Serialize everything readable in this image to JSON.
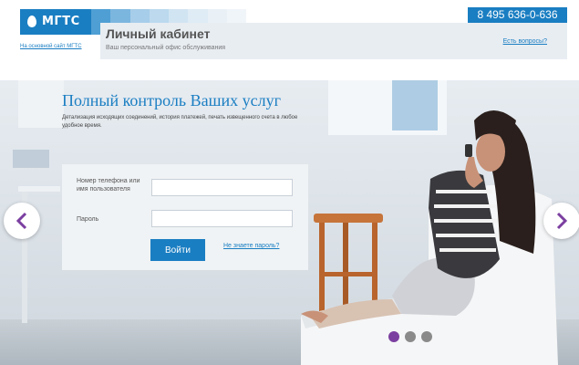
{
  "brand": {
    "logo_text": "МГТС",
    "main_site_link": "На основной сайт МГТС"
  },
  "header": {
    "title": "Личный кабинет",
    "subtitle": "Ваш персональный офис обслуживания",
    "phone": "8 495 636-0-636",
    "faq_link": "Есть вопросы?"
  },
  "hero": {
    "heading": "Полный контроль Ваших услуг",
    "description": "Детализация исходящих соединений, история платежей, печать извещенного счета в любое удобное время."
  },
  "login": {
    "phone_label": "Номер телефона или имя пользователя",
    "phone_value": "",
    "password_label": "Пароль",
    "password_value": "",
    "submit_label": "Войти",
    "forgot_link": "Не знаете пароль?"
  },
  "carousel": {
    "slide_count": 3,
    "active_index": 0
  },
  "colors": {
    "accent": "#1a7ec2",
    "dot_active": "#7b3fa0",
    "dot_inactive": "#8a8a8a"
  },
  "icons": {
    "prev": "chevron-left-icon",
    "next": "chevron-right-icon",
    "logo": "mgts-egg-icon"
  }
}
